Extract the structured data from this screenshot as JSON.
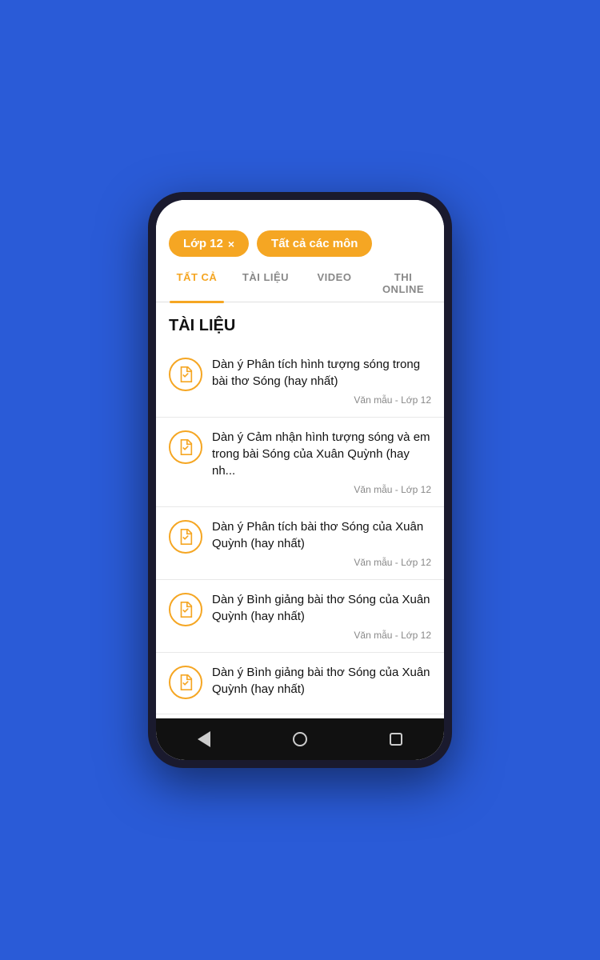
{
  "colors": {
    "accent": "#f5a623",
    "active_tab": "#f5a623",
    "inactive_tab": "#888888",
    "text_dark": "#111111",
    "text_meta": "#888888",
    "bg": "#ffffff"
  },
  "filters": {
    "chip1_label": "Lớp 12",
    "chip1_close": "×",
    "chip2_label": "Tất cả các môn"
  },
  "tabs": [
    {
      "label": "TẤT CẢ",
      "active": true
    },
    {
      "label": "TÀI LIỆU",
      "active": false
    },
    {
      "label": "VIDEO",
      "active": false
    },
    {
      "label": "THI ONLINE",
      "active": false
    }
  ],
  "section_title": "TÀI LIỆU",
  "items": [
    {
      "title": "Dàn ý Phân tích hình tượng sóng trong bài thơ Sóng  (hay nhất)",
      "meta": "Văn mẫu - Lớp 12"
    },
    {
      "title": "Dàn ý Cảm nhận hình tượng sóng và em trong bài Sóng của Xuân Quỳnh  (hay nh...",
      "meta": "Văn mẫu - Lớp 12"
    },
    {
      "title": "Dàn ý Phân tích bài thơ Sóng của Xuân Quỳnh  (hay nhất)",
      "meta": "Văn mẫu - Lớp 12"
    },
    {
      "title": "Dàn ý Bình giảng bài thơ Sóng của Xuân Quỳnh  (hay nhất)",
      "meta": "Văn mẫu - Lớp 12"
    },
    {
      "title": "Dàn ý Bình giảng bài thơ Sóng của Xuân Quỳnh  (hay nhất)",
      "meta": ""
    }
  ]
}
